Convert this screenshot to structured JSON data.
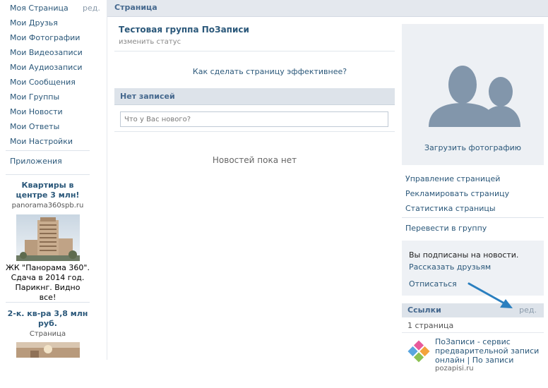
{
  "sidebar": {
    "nav": [
      {
        "label": "Моя Страница"
      },
      {
        "label": "Мои Друзья"
      },
      {
        "label": "Мои Фотографии"
      },
      {
        "label": "Мои Видеозаписи"
      },
      {
        "label": "Мои Аудиозаписи"
      },
      {
        "label": "Мои Сообщения"
      },
      {
        "label": "Мои Группы"
      },
      {
        "label": "Мои Новости"
      },
      {
        "label": "Мои Ответы"
      },
      {
        "label": "Мои Настройки"
      }
    ],
    "edit_label": "ред.",
    "apps_label": "Приложения",
    "ads": [
      {
        "title": "Квартиры в центре 3 млн!",
        "domain": "panorama360spb.ru",
        "text": "ЖК \"Панорама 360\". Сдача в 2014 год. Парикнг. Видно все!"
      },
      {
        "title": "2-к. кв-ра 3,8 млн руб.",
        "domain": "Страница"
      }
    ]
  },
  "topbar": {
    "title": "Страница"
  },
  "center": {
    "group_title": "Тестовая группа ПоЗаписи",
    "status_link": "изменить статус",
    "effective_link": "Как сделать страницу эффективнее?",
    "no_posts_header": "Нет записей",
    "post_placeholder": "Что у Вас нового?",
    "no_news": "Новостей пока нет"
  },
  "right": {
    "upload_photo": "Загрузить фотографию",
    "actions": [
      {
        "label": "Управление страницей"
      },
      {
        "label": "Рекламировать страницу"
      },
      {
        "label": "Статистика страницы"
      }
    ],
    "convert_group": "Перевести в группу",
    "subscribed_text": "Вы подписаны на новости.",
    "tell_friends": "Рассказать друзьям",
    "unsubscribe": "Отписаться",
    "links": {
      "title": "Ссылки",
      "edit": "ред.",
      "count": "1 страница",
      "item_title": "ПоЗаписи - сервис предварительной записи онлайн | По записи",
      "item_domain": "pozapisi.ru"
    }
  },
  "colors": {
    "link": "#2B587A",
    "header_text": "#45688E",
    "header_bg": "#DDE3EA",
    "arrow": "#2A7FBF"
  }
}
